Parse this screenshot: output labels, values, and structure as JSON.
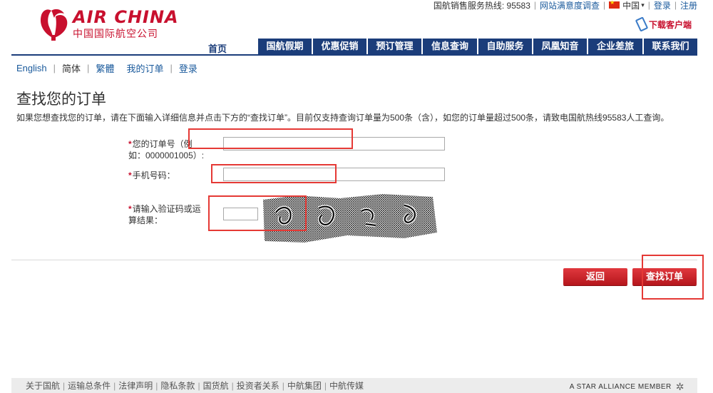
{
  "brand": {
    "name_en": "AIR CHINA",
    "name_cn": "中国国际航空公司"
  },
  "topbar": {
    "hotline": "国航销售服务热线: 95583",
    "survey": "网站满意度调查",
    "region": "中国",
    "login": "登录",
    "register": "注册"
  },
  "download": "下载客户端",
  "nav": {
    "home": "首页",
    "items": [
      "国航假期",
      "优惠促销",
      "预订管理",
      "信息查询",
      "自助服务",
      "凤凰知音",
      "企业差旅",
      "联系我们"
    ]
  },
  "sublinks": {
    "english": "English",
    "simplified": "简体",
    "traditional": "繁體",
    "my_orders": "我的订单",
    "login": "登录"
  },
  "page": {
    "title": "查找您的订单",
    "description": "如果您想查找您的订单，请在下面输入详细信息并点击下方的“查找订单”。目前仅支持查询订单量为500条（含），如您的订单量超过500条，请致电国航热线95583人工查询。"
  },
  "form": {
    "order_label": "您的订单号（例如：0000001005）:",
    "order_value": "",
    "phone_label": "手机号码：",
    "phone_value": "",
    "captcha_label": "请输入验证码或运算结果：",
    "captcha_value": ""
  },
  "buttons": {
    "back": "返回",
    "find": "查找订单"
  },
  "footer": {
    "links": [
      "关于国航",
      "运输总条件",
      "法律声明",
      "隐私条款",
      "国货航",
      "投资者关系",
      "中航集团",
      "中航传媒"
    ],
    "star_alliance": "A STAR ALLIANCE MEMBER"
  },
  "colors": {
    "brand_red": "#c8102e",
    "nav_blue": "#1b3d7a",
    "highlight": "#e53935"
  }
}
